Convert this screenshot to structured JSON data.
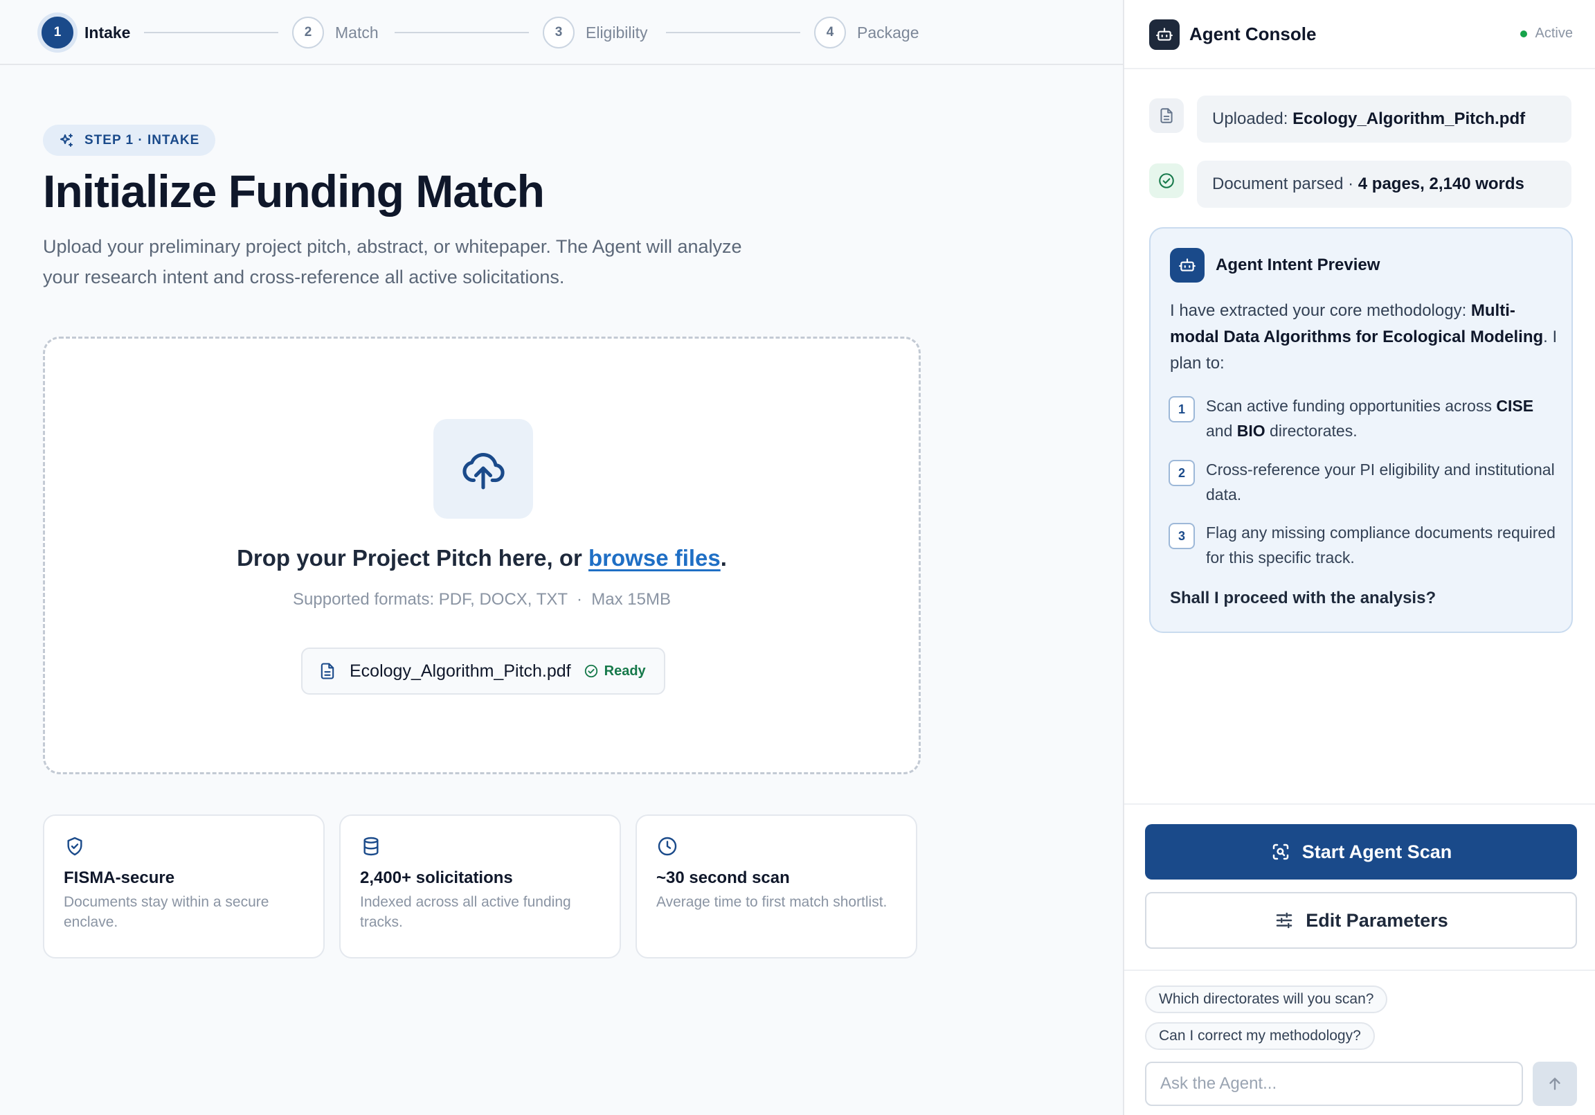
{
  "stepper": {
    "steps": [
      {
        "num": "1",
        "label": "Intake"
      },
      {
        "num": "2",
        "label": "Match"
      },
      {
        "num": "3",
        "label": "Eligibility"
      },
      {
        "num": "4",
        "label": "Package"
      }
    ],
    "active_index": 0
  },
  "intake": {
    "badge": "STEP 1 · INTAKE",
    "title": "Initialize Funding Match",
    "description": "Upload your preliminary project pitch, abstract, or whitepaper. The Agent will analyze your research intent and cross-reference all active solicitations."
  },
  "dropzone": {
    "text_before": "Drop your Project Pitch here, or ",
    "link": "browse files",
    "text_after": ".",
    "hint": "Supported formats: PDF, DOCX, TXT  ·  Max 15MB",
    "file": {
      "name": "Ecology_Algorithm_Pitch.pdf",
      "status": "Ready"
    }
  },
  "features": [
    {
      "icon": "shield-check-icon",
      "title": "FISMA-secure",
      "desc": "Documents stay within a secure enclave."
    },
    {
      "icon": "database-icon",
      "title": "2,400+ solicitations",
      "desc": "Indexed across all active funding tracks."
    },
    {
      "icon": "clock-icon",
      "title": "~30 second scan",
      "desc": "Average time to first match shortlist."
    }
  ],
  "console": {
    "title": "Agent Console",
    "status": "Active",
    "log": [
      {
        "icon": "file-icon",
        "prefix": "Uploaded: ",
        "bold": "Ecology_Algorithm_Pitch.pdf"
      },
      {
        "icon": "check-circle-icon",
        "prefix": "Document parsed · ",
        "bold": "4 pages, 2,140 words"
      }
    ],
    "intent": {
      "title": "Agent Intent Preview",
      "intro_before": "I have extracted your core methodology: ",
      "intro_bold": "Multi-modal Data Algorithms for Ecological Modeling",
      "intro_after": ". I plan to:",
      "steps": [
        {
          "num": "1",
          "t1": "Scan active funding opportunities across ",
          "b1": "CISE",
          "t2": " and ",
          "b2": "BIO",
          "t3": " directorates."
        },
        {
          "num": "2",
          "text": "Cross-reference your PI eligibility and institutional data."
        },
        {
          "num": "3",
          "text": "Flag any missing compliance documents required for this specific track."
        }
      ],
      "question": "Shall I proceed with the analysis?"
    },
    "primary_button": "Start Agent Scan",
    "secondary_button": "Edit Parameters",
    "suggestions": [
      "Which directorates will you scan?",
      "Can I correct my methodology?"
    ],
    "input_placeholder": "Ask the Agent...",
    "colors": {
      "primary": "#1a4a8a",
      "success": "#16a34a"
    }
  }
}
